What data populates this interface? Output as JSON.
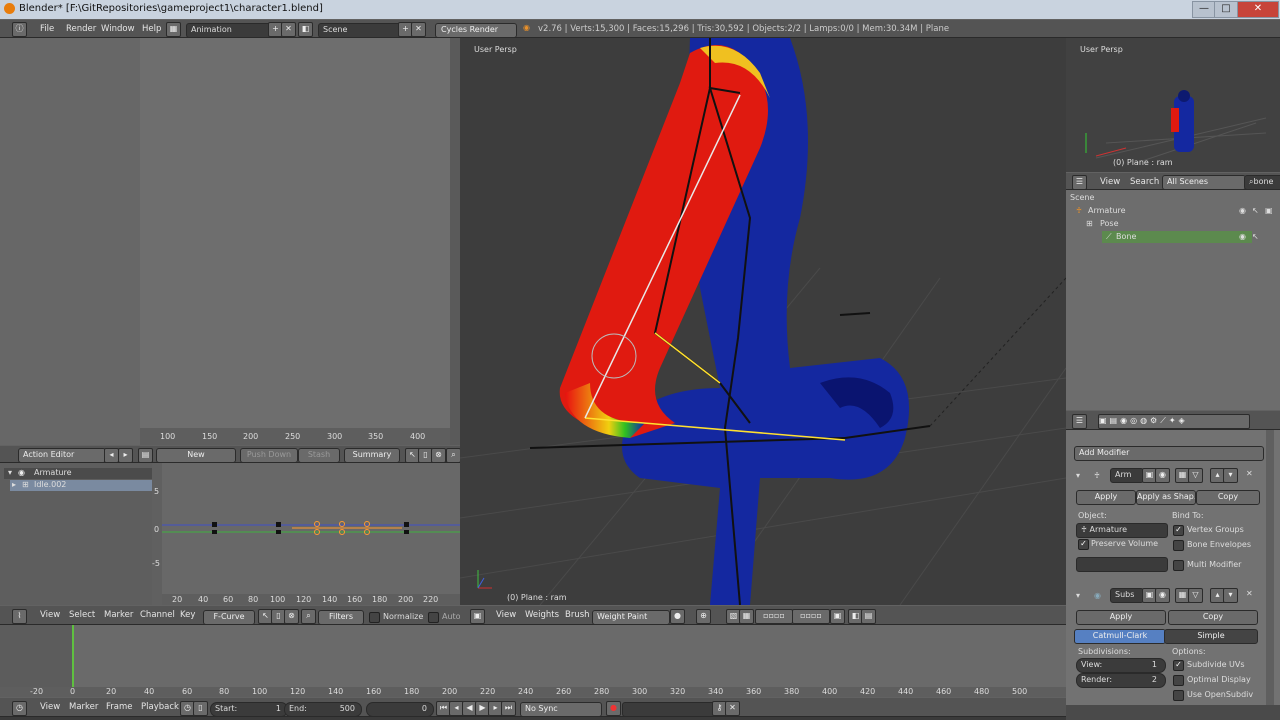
{
  "window": {
    "title": "Blender* [F:\\GitRepositories\\gameproject1\\character1.blend]",
    "min": "—",
    "max": "□",
    "close": "✕"
  },
  "info": {
    "menus": [
      "File",
      "Render",
      "Window",
      "Help"
    ],
    "screen": "Animation",
    "scene": "Scene",
    "engine": "Cycles Render",
    "stats": "v2.76 | Verts:15,300 | Faces:15,296 | Tris:30,592 | Objects:2/2 | Lamps:0/0 | Mem:30.34M | Plane"
  },
  "graph_top": {
    "ticks": [
      "100",
      "150",
      "200",
      "250",
      "300",
      "350",
      "400"
    ]
  },
  "action_editor": {
    "mode": "Action Editor",
    "new": "New",
    "push_down": "Push Down",
    "stash": "Stash",
    "summary": "Summary"
  },
  "dopesheet": {
    "channels": [
      "Armature",
      "Idle.002"
    ]
  },
  "graph_bottom": {
    "ticks": [
      "20",
      "40",
      "60",
      "80",
      "100",
      "120",
      "140",
      "160",
      "180",
      "200",
      "220"
    ],
    "yticks": [
      "5",
      "0",
      "-5"
    ],
    "menus": [
      "View",
      "Select",
      "Marker",
      "Channel",
      "Key"
    ],
    "mode": "F-Curve",
    "filters": "Filters",
    "normalize": "Normalize",
    "auto": "Auto"
  },
  "viewport": {
    "label": "User Persp",
    "object": "(0) Plane : ram",
    "menus": [
      "View",
      "Weights",
      "Brush"
    ],
    "mode": "Weight Paint"
  },
  "mini_view": {
    "label": "User Persp",
    "object": "(0) Plane : ram"
  },
  "outliner": {
    "menus": [
      "View",
      "Search"
    ],
    "filter": "All Scenes",
    "search": "bone",
    "tree": [
      "Scene",
      "Armature",
      "Pose",
      "Bone"
    ]
  },
  "properties": {
    "add_modifier": "Add Modifier",
    "arm": {
      "name": "Arm",
      "apply": "Apply",
      "apply_shape": "Apply as Shap...",
      "copy": "Copy",
      "object_label": "Object:",
      "object": "Armature",
      "preserve": "Preserve Volume",
      "bind_to": "Bind To:",
      "vgroups": "Vertex Groups",
      "envelopes": "Bone Envelopes",
      "multi": "Multi Modifier"
    },
    "subs": {
      "name": "Subs",
      "apply": "Apply",
      "copy": "Copy",
      "catmull": "Catmull-Clark",
      "simple": "Simple",
      "subdivisions": "Subdivisions:",
      "view": "View:",
      "view_val": "1",
      "render": "Render:",
      "render_val": "2",
      "options": "Options:",
      "subdiv_uvs": "Subdivide UVs",
      "optimal": "Optimal Display",
      "opensubdiv": "Use OpenSubdiv"
    }
  },
  "timeline": {
    "ticks": [
      "-20",
      "0",
      "20",
      "40",
      "60",
      "80",
      "100",
      "120",
      "140",
      "160",
      "180",
      "200",
      "220",
      "240",
      "260",
      "280",
      "300",
      "320",
      "340",
      "360",
      "380",
      "400",
      "420",
      "440",
      "460",
      "480",
      "500"
    ],
    "menus": [
      "View",
      "Marker",
      "Frame",
      "Playback"
    ],
    "start": "Start:",
    "start_val": "1",
    "end": "End:",
    "end_val": "500",
    "frame": "0",
    "sync": "No Sync"
  }
}
